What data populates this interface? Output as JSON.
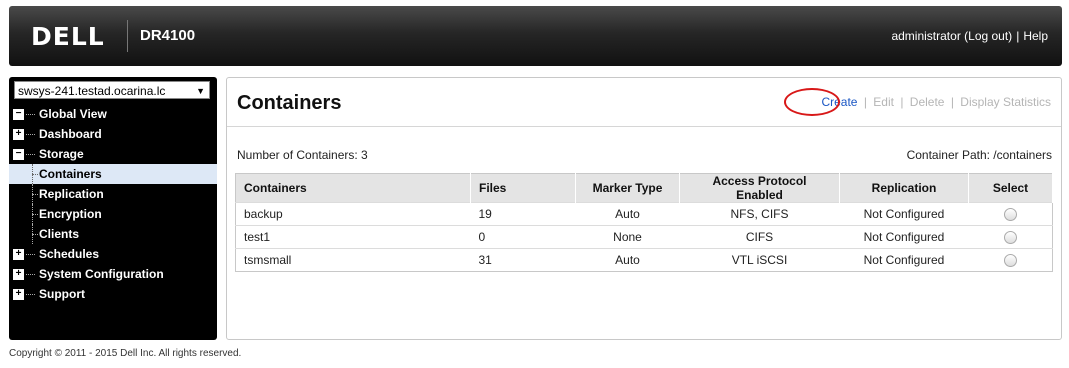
{
  "header": {
    "logo": "DELL",
    "product": "DR4100",
    "user_link": "administrator (Log out)",
    "separator": "|",
    "help_link": "Help"
  },
  "sidebar": {
    "host_select": "swsys-241.testad.ocarina.lc",
    "tree": [
      {
        "label": "Global View",
        "expander": "−"
      },
      {
        "label": "Dashboard",
        "expander": "+"
      },
      {
        "label": "Storage",
        "expander": "−"
      }
    ],
    "storage_children": [
      "Containers",
      "Replication",
      "Encryption",
      "Clients"
    ],
    "tree_after": [
      {
        "label": "Schedules",
        "expander": "+"
      },
      {
        "label": "System Configuration",
        "expander": "+"
      },
      {
        "label": "Support",
        "expander": "+"
      }
    ]
  },
  "main": {
    "title": "Containers",
    "actions": {
      "create": "Create",
      "edit": "Edit",
      "delete": "Delete",
      "stats": "Display Statistics",
      "sep": "|"
    },
    "count": "Number of Containers: 3",
    "path": "Container Path: /containers",
    "columns": [
      "Containers",
      "Files",
      "Marker Type",
      "Access Protocol Enabled",
      "Replication",
      "Select"
    ],
    "rows": [
      [
        "backup",
        "19",
        "Auto",
        "NFS, CIFS",
        "Not Configured"
      ],
      [
        "test1",
        "0",
        "None",
        "CIFS",
        "Not Configured"
      ],
      [
        "tsmsmall",
        "31",
        "Auto",
        "VTL iSCSI",
        "Not Configured"
      ]
    ]
  },
  "footer": {
    "copyright": "Copyright © 2011 - 2015 Dell Inc. All rights reserved."
  },
  "colors": {
    "create_link": "#1a56c4",
    "highlight_circle": "#d81818",
    "active_nav": "#dde8f6"
  }
}
